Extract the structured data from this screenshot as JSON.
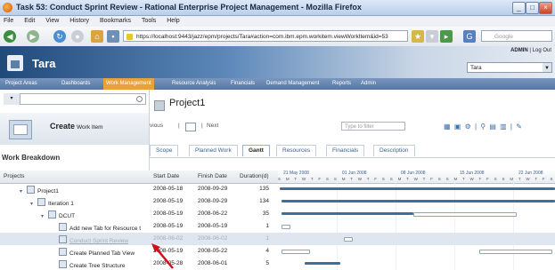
{
  "window": {
    "title": "Task 53: Conduct Sprint Review - Rational Enterprise Project Management - Mozilla Firefox"
  },
  "menubar": [
    "File",
    "Edit",
    "View",
    "History",
    "Bookmarks",
    "Tools",
    "Help"
  ],
  "browser": {
    "url": "https://localhost:9443/jazz/epm/projects/Tara#action=com.ibm.epm.workitem.viewWorkItem&id=53",
    "search_placeholder": "Google"
  },
  "app": {
    "name": "Tara",
    "user": "ADMIN",
    "logout": "Log Out",
    "project_select": "Tara"
  },
  "main_nav": [
    "Project Areas",
    "Dashboards",
    "Work Management",
    "Resource Analysis",
    "Financials",
    "Demand Management",
    "Reports",
    "Admin"
  ],
  "main_nav_active": "Work Management",
  "left": {
    "create_label": "Create",
    "create_sub": "Work Item",
    "section_title": "Work Breakdown"
  },
  "content": {
    "project_title": "Project1",
    "toolbar_prev": "vious",
    "toolbar_next": "Next",
    "filter_placeholder": "Type to filter",
    "view_tabs": [
      "Scope",
      "Planned Work",
      "Gantt",
      "Resources",
      "Financials",
      "Description"
    ],
    "active_tab": "Gantt"
  },
  "grid": {
    "columns": [
      "Projects",
      "Start Date",
      "Finish Date",
      "Duration(d)"
    ],
    "weeks": [
      "21 May 2008",
      "01 Jun 2008",
      "08 Jun 2008",
      "15 Jun 2008",
      "22 Jun 2008"
    ],
    "day_letters": "S M T W T F S S M T W T F S S M T W T F S S M T W T F S S M T W T F S S M T",
    "rows": [
      {
        "name": "Project1",
        "start": "2008-05-18",
        "finish": "2008-09-29",
        "duration": "135",
        "level": 0,
        "expand": "v"
      },
      {
        "name": "Iteration 1",
        "start": "2008-05-19",
        "finish": "2008-09-29",
        "duration": "134",
        "level": 1,
        "expand": "v"
      },
      {
        "name": "DCUT",
        "start": "2008-05-19",
        "finish": "2008-06-22",
        "duration": "35",
        "level": 2,
        "expand": "v"
      },
      {
        "name": "Add new Tab for Resource t",
        "start": "2008-05-19",
        "finish": "2008-05-19",
        "duration": "1",
        "level": 3,
        "expand": ""
      },
      {
        "name": "Conduct Sprint Review",
        "start": "2008-06-02",
        "finish": "2008-06-02",
        "duration": "1",
        "level": 3,
        "expand": "",
        "selected": true
      },
      {
        "name": "Create Planned Tab View",
        "start": "2008-05-19",
        "finish": "2008-05-22",
        "duration": "4",
        "level": 3,
        "expand": ""
      },
      {
        "name": "Create Tree Structure",
        "start": "2008-05-28",
        "finish": "2008-06-01",
        "duration": "5",
        "level": 3,
        "expand": ""
      }
    ]
  }
}
